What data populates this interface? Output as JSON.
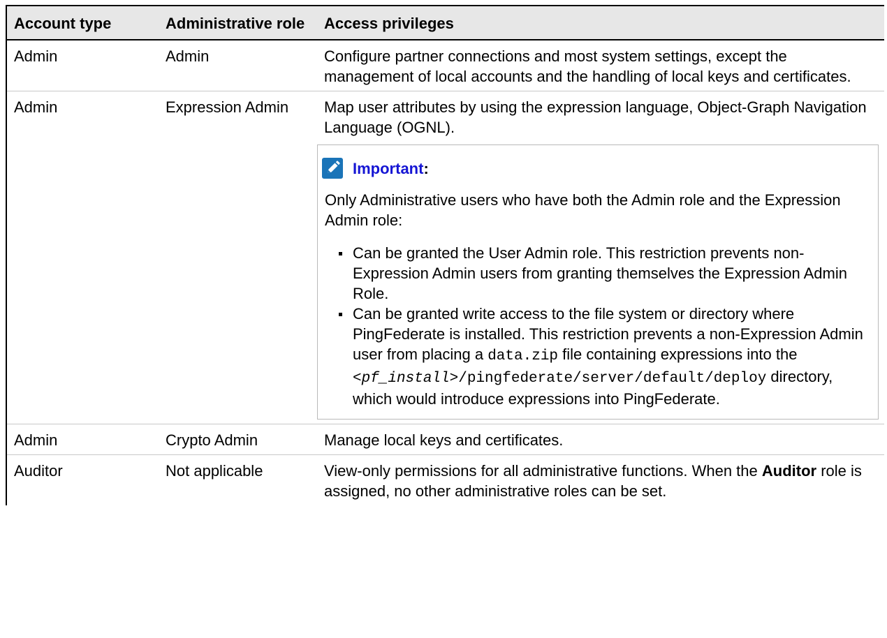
{
  "table": {
    "headers": [
      "Account type",
      "Administrative role",
      "Access privileges"
    ],
    "rows": [
      {
        "account_type": "Admin",
        "role": "Admin",
        "privileges": "Configure partner connections and most system settings, except the management of local accounts and the handling of local keys and certificates."
      },
      {
        "account_type": "Admin",
        "role": "Expression Admin",
        "privileges": "Map user attributes by using the expression language, Object-Graph Navigation Language (OGNL).",
        "note": {
          "label": "Important",
          "colon": ":",
          "icon": "pencil-edit-icon",
          "body": "Only Administrative users who have both the Admin role and the Expression Admin role:",
          "items": [
            {
              "text": "Can be granted the User Admin role. This restriction prevents non-Expression Admin users from granting themselves the Expression Admin Role."
            },
            {
              "part1": "Can be granted write access to the file system or directory where PingFederate is installed. This restriction prevents a non-Expression Admin user from placing a ",
              "code1": "data.zip",
              "part2": " file containing expressions into the ",
              "code2_italic": "<pf_install>",
              "code2": "/pingfederate/server/default/deploy",
              "part3": " directory, which would introduce expressions into PingFederate."
            }
          ]
        }
      },
      {
        "account_type": "Admin",
        "role": "Crypto Admin",
        "privileges": "Manage local keys and certificates."
      },
      {
        "account_type": "Auditor",
        "role": "Not applicable",
        "privileges_part1": "View-only permissions for all administrative functions. When the ",
        "privileges_bold": "Auditor",
        "privileges_part2": " role is assigned, no other administrative roles can be set."
      }
    ]
  }
}
